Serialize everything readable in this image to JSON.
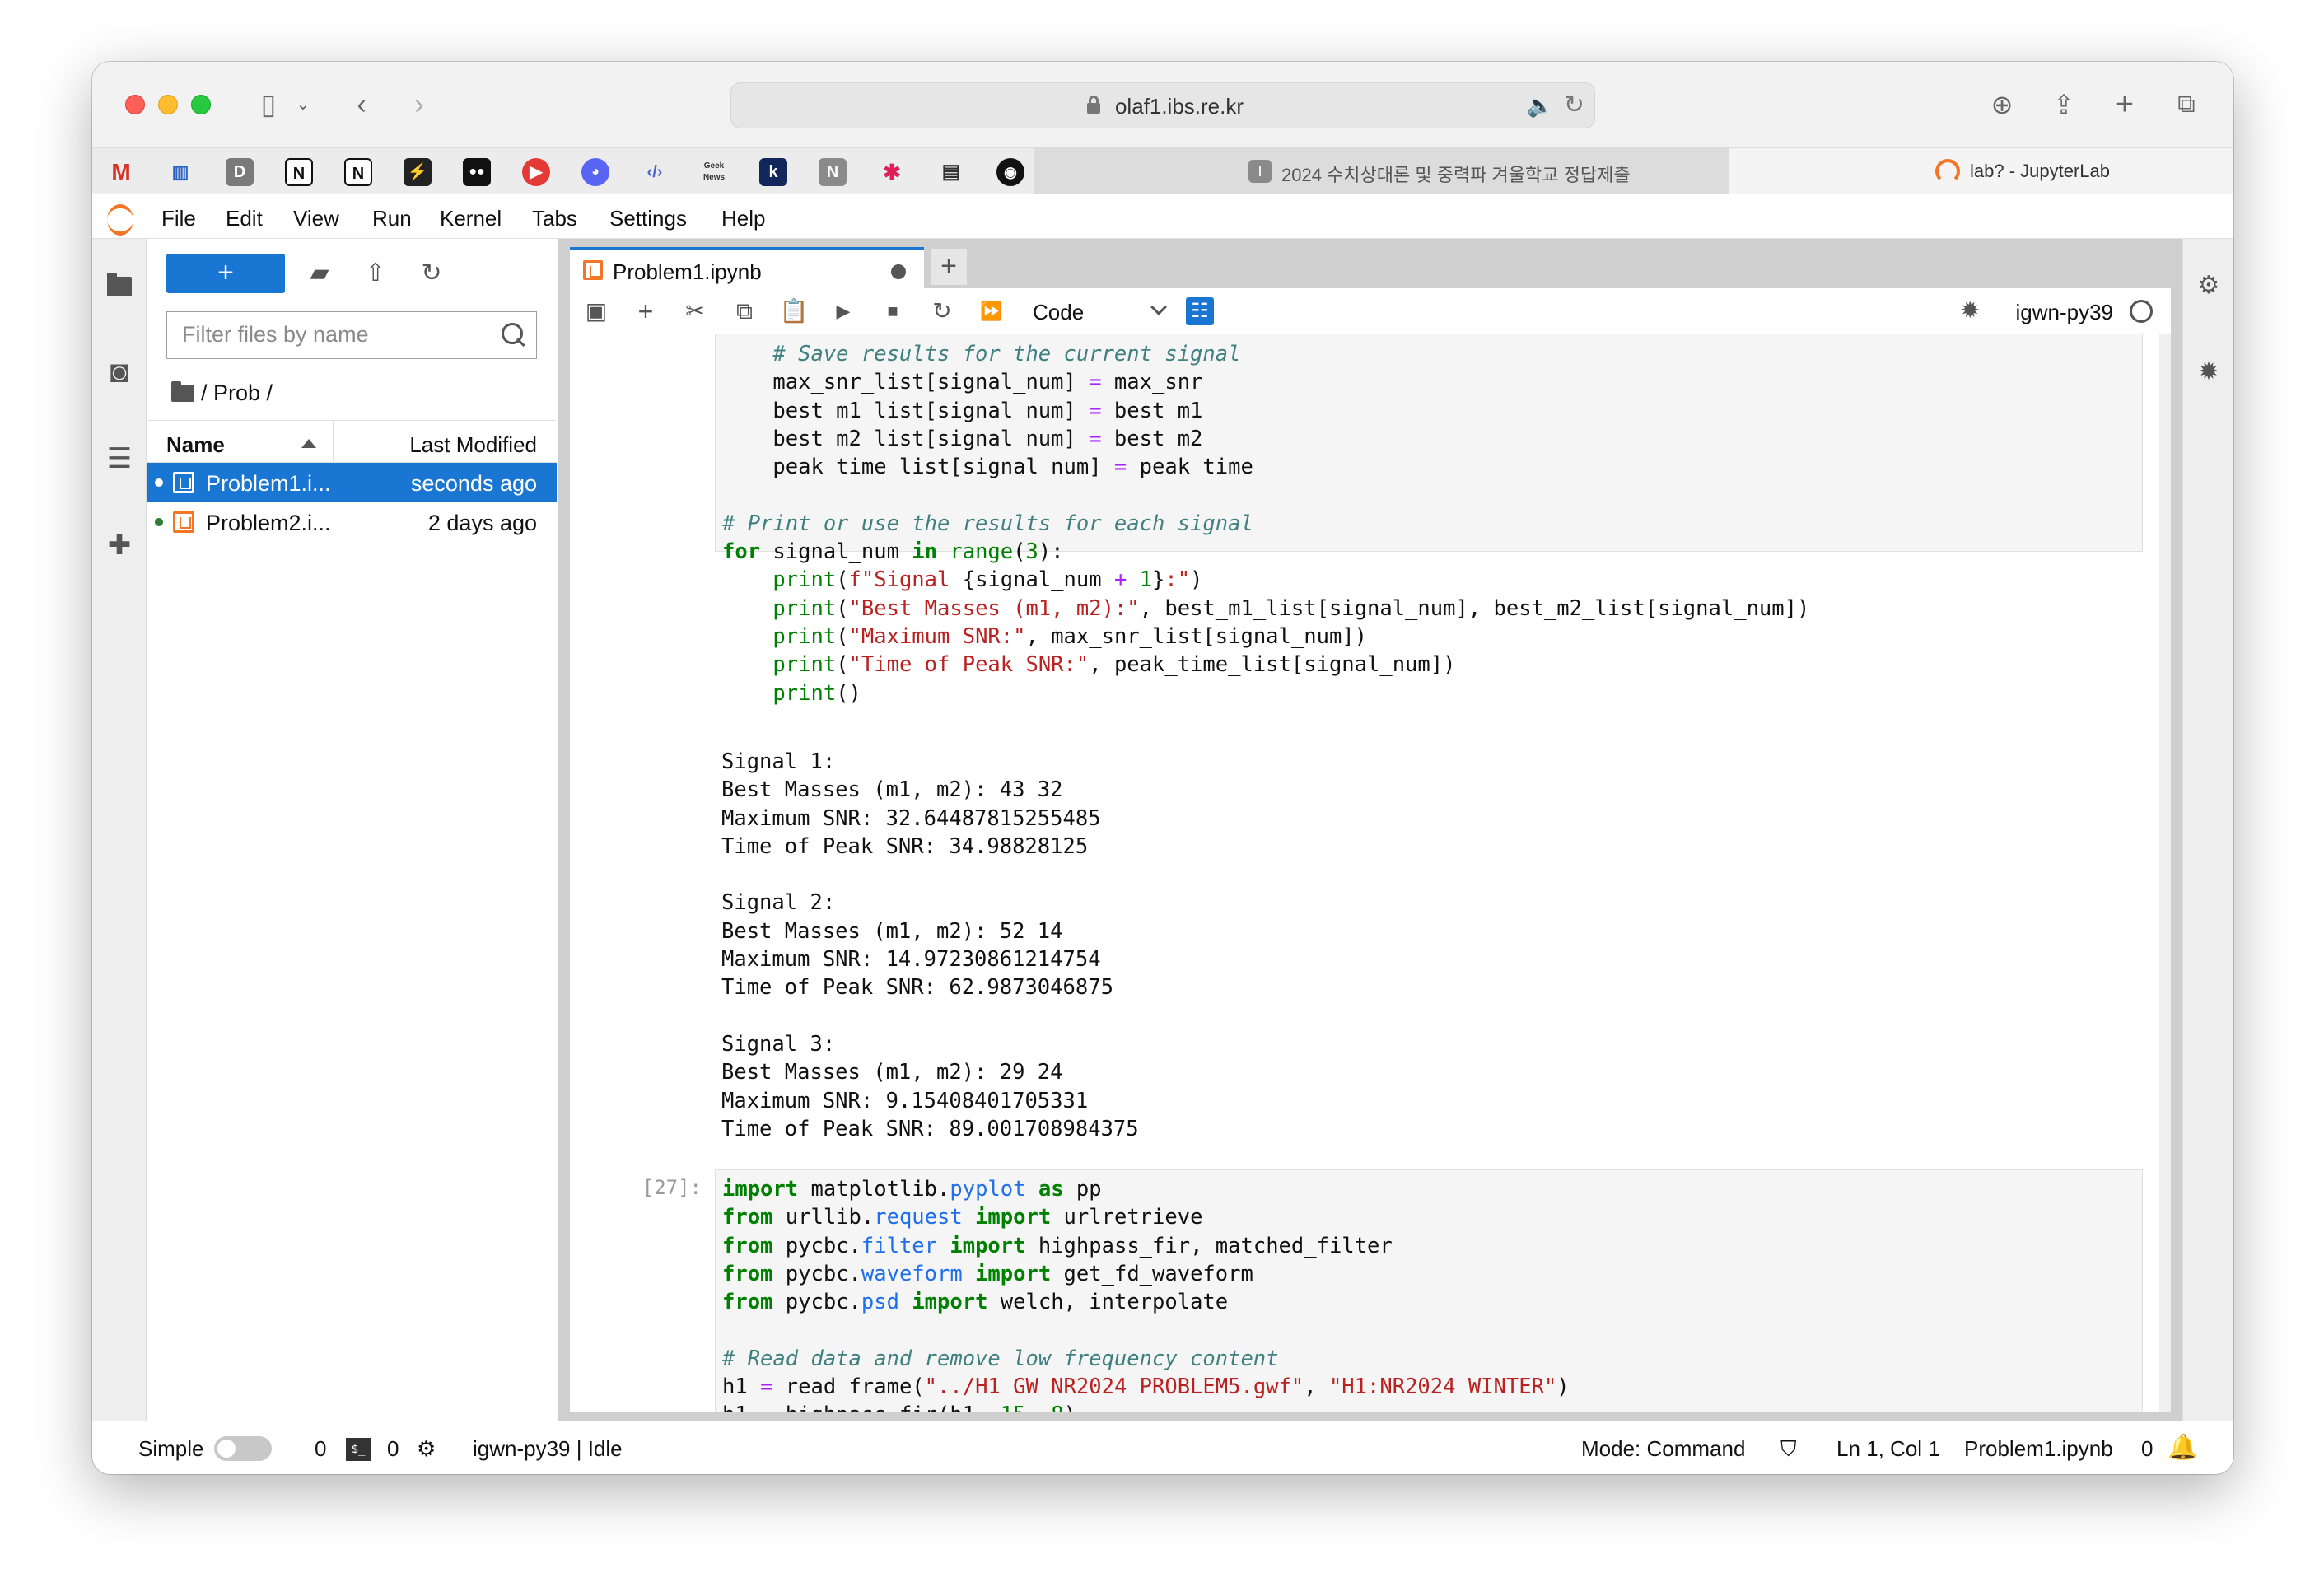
{
  "browser": {
    "url": "olaf1.ibs.re.kr",
    "tabs": [
      {
        "title": "2024 수치상대론 및 중력파 겨울학교 정답제출",
        "active": false
      },
      {
        "title": "lab? - JupyterLab",
        "active": true
      }
    ],
    "favorites": [
      "gmail-icon",
      "barcode-icon",
      "d-icon",
      "notion-icon",
      "notion-icon-2",
      "bolt-icon",
      "medium-icon",
      "youtube-icon",
      "discord-icon",
      "code-icon",
      "geeknews-icon",
      "k-icon",
      "n-icon",
      "slack-icon",
      "page-icon",
      "github-icon"
    ],
    "favorite_letters": {
      "d": "D",
      "k": "k",
      "n": "N",
      "geeknews": "Geek News"
    }
  },
  "menu": [
    "File",
    "Edit",
    "View",
    "Run",
    "Kernel",
    "Tabs",
    "Settings",
    "Help"
  ],
  "filebrowser": {
    "new_label": "+",
    "filter_placeholder": "Filter files by name",
    "breadcrumb": "/ Prob /",
    "col_name": "Name",
    "col_modified": "Last Modified",
    "files": [
      {
        "name": "Problem1.i...",
        "modified": "seconds ago",
        "selected": true,
        "running": true
      },
      {
        "name": "Problem2.i...",
        "modified": "2 days ago",
        "selected": false,
        "running": true
      }
    ]
  },
  "notebook": {
    "tab_title": "Problem1.ipynb",
    "cell_type": "Code",
    "kernel": "igwn-py39",
    "cells": [
      {
        "prompt": ""
      },
      {
        "prompt": "[27]:"
      }
    ],
    "output_text": "Signal 1:\nBest Masses (m1, m2): 43 32\nMaximum SNR: 32.64487815255485\nTime of Peak SNR: 34.98828125\n\nSignal 2:\nBest Masses (m1, m2): 52 14\nMaximum SNR: 14.97230861214754\nTime of Peak SNR: 62.9873046875\n\nSignal 3:\nBest Masses (m1, m2): 29 24\nMaximum SNR: 9.15408401705331\nTime of Peak SNR: 89.001708984375"
  },
  "status": {
    "mode_label": "Simple",
    "count_a": "0",
    "count_b": "0",
    "kernel_status": "igwn-py39 | Idle",
    "mode": "Mode: Command",
    "cursor": "Ln 1, Col 1",
    "file": "Problem1.ipynb",
    "notifications": "0"
  },
  "colors": {
    "accent": "#1976d2",
    "jupyter_orange": "#f37626"
  }
}
